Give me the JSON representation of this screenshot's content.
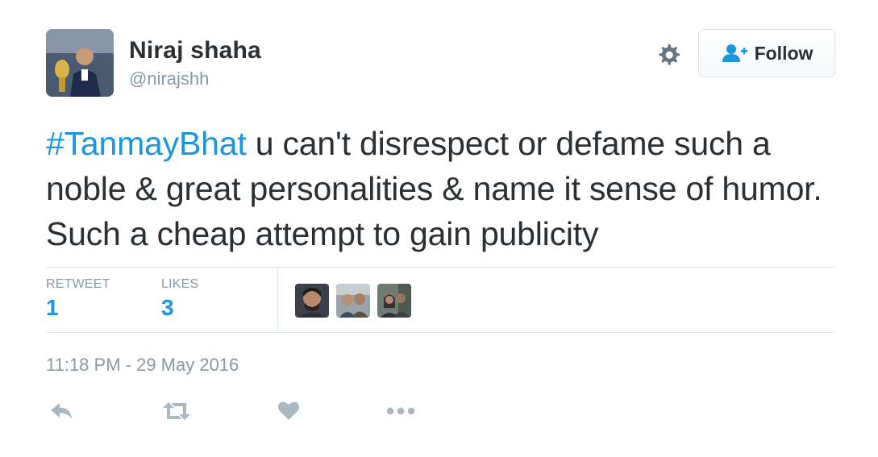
{
  "author": {
    "name": "Niraj shaha",
    "handle": "@nirajshh"
  },
  "header": {
    "settings_icon": "gear-icon",
    "follow_label": "Follow",
    "follow_icon": "person-add-icon"
  },
  "tweet": {
    "hashtag": "#TanmayBhat",
    "text": " u can't disrespect or defame such a noble & great personalities & name it sense of humor. Such a cheap attempt to gain publicity"
  },
  "stats": {
    "retweet_label": "RETWEET",
    "retweet_count": "1",
    "likes_label": "LIKES",
    "likes_count": "3"
  },
  "timestamp": "11:18 PM - 29 May 2016",
  "actions": [
    "reply-icon",
    "retweet-icon",
    "like-icon",
    "more-icon"
  ],
  "colors": {
    "accent": "#1b95e0",
    "text": "#292f33",
    "muted": "#8899a6",
    "icon": "#aab8c2",
    "border": "#e1e8ed"
  }
}
